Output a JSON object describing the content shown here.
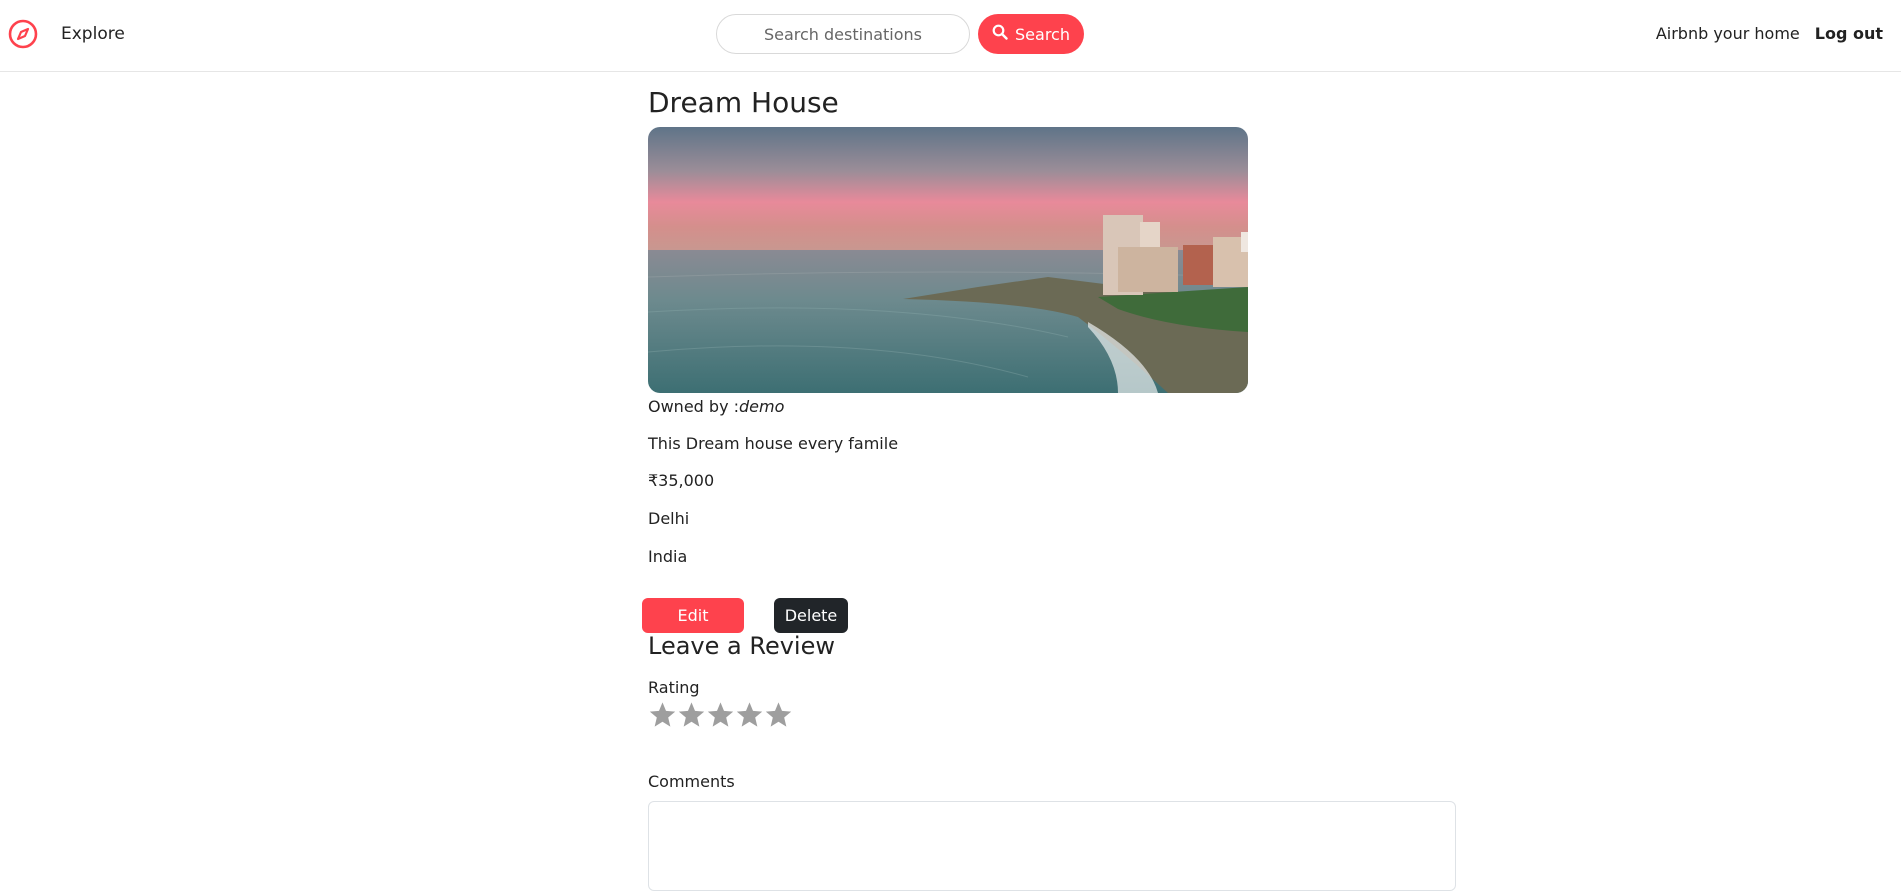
{
  "navbar": {
    "brand_icon": "compass-icon",
    "explore_label": "Explore",
    "search_placeholder": "Search destinations",
    "search_button_label": "Search",
    "search_button_icon": "search-icon",
    "host_link_label": "Airbnb your home",
    "logout_label": "Log out"
  },
  "listing": {
    "title": "Dream House",
    "image_description": "sunset-coastline-photo",
    "owner_prefix": "Owned by :",
    "owner_name": "demo",
    "description": "This Dream house every famile",
    "price": "₹35,000",
    "location": "Delhi",
    "country": "India",
    "edit_label": "Edit",
    "delete_label": "Delete"
  },
  "review": {
    "heading": "Leave a Review",
    "rating_label": "Rating",
    "stars_total": 5,
    "stars_selected": 0,
    "comments_label": "Comments",
    "comments_value": ""
  },
  "colors": {
    "accent": "#fe424d",
    "dark_button": "#212529",
    "star_inactive": "#9e9e9e"
  }
}
